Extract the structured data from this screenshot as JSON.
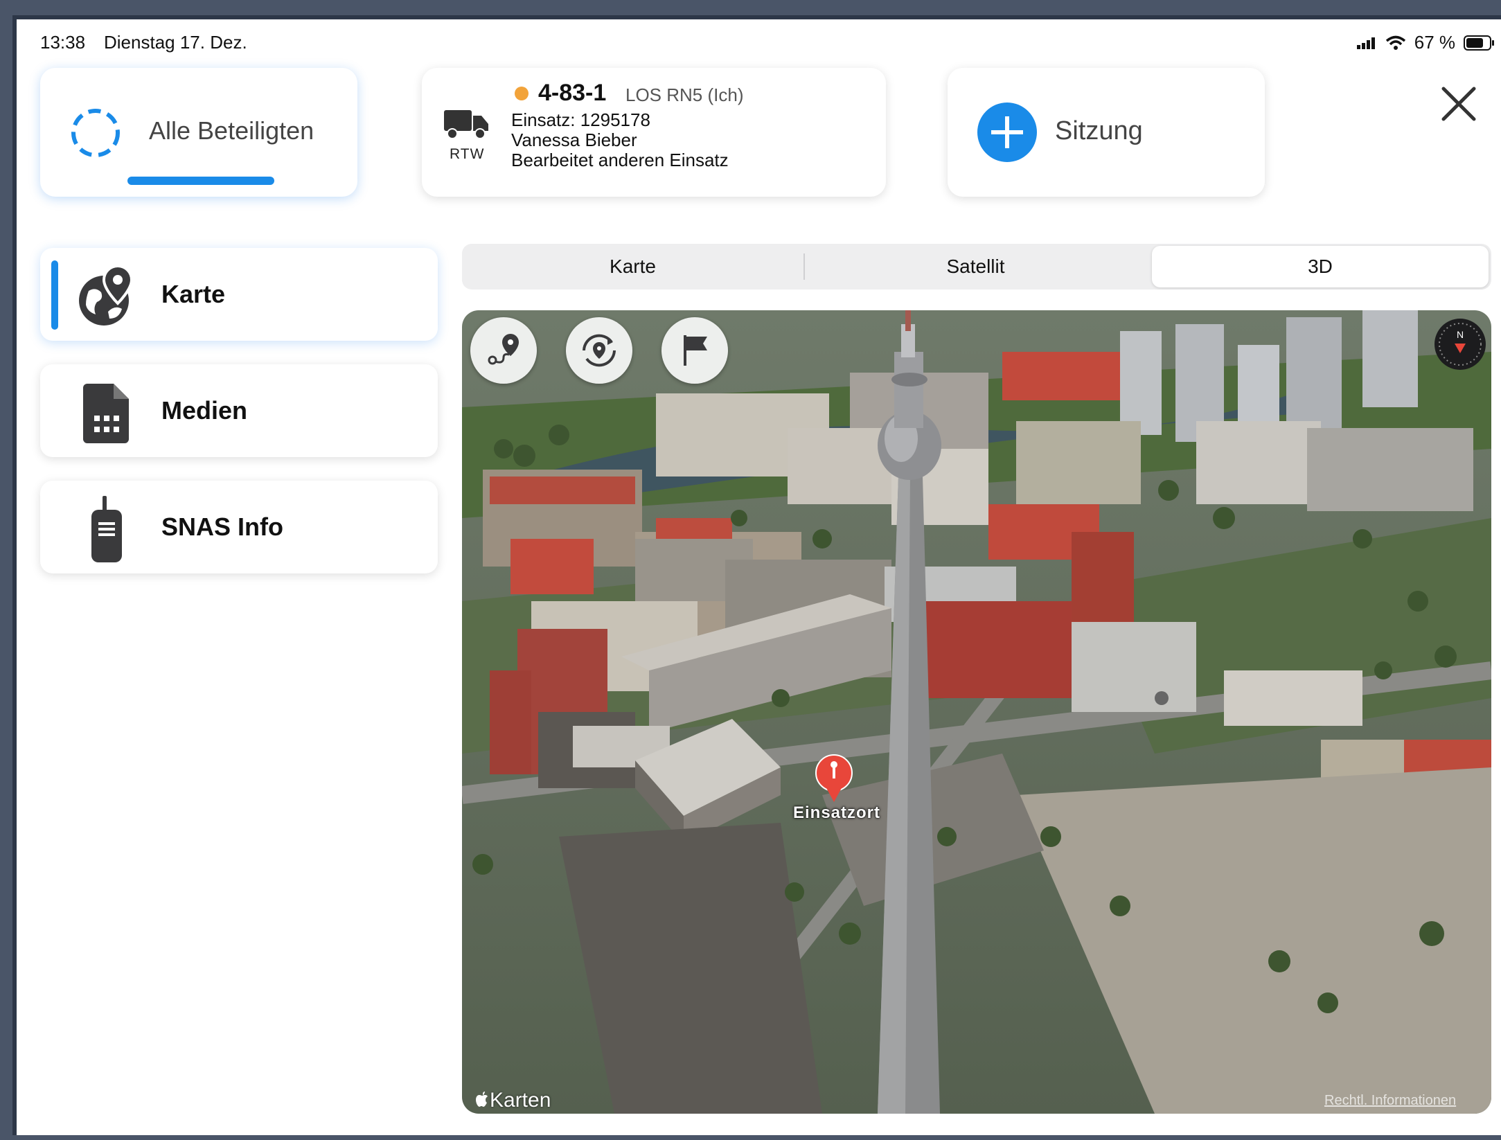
{
  "status": {
    "time": "13:38",
    "date": "Dienstag 17. Dez.",
    "battery": "67 %"
  },
  "header": {
    "all_participants": "Alle Beteiligten",
    "unit": {
      "callsign": "4-83-1",
      "subtitle": "LOS RN5 (Ich)",
      "type": "RTW",
      "line1": "Einsatz: 1295178",
      "line2": "Vanessa Bieber",
      "line3": "Bearbeitet anderen Einsatz",
      "status_color": "#f2a33a"
    },
    "session": "Sitzung"
  },
  "sidebar": {
    "items": [
      {
        "label": "Karte",
        "icon": "globe-pin-icon",
        "active": true
      },
      {
        "label": "Medien",
        "icon": "document-grid-icon",
        "active": false
      },
      {
        "label": "SNAS Info",
        "icon": "walkie-talkie-icon",
        "active": false
      }
    ]
  },
  "map_mode": {
    "options": [
      "Karte",
      "Satellit",
      "3D"
    ],
    "selected": "3D"
  },
  "map": {
    "marker_label": "Einsatzort",
    "attribution": "Karten",
    "legal": "Rechtl. Informationen",
    "compass_letter": "N",
    "buttons": [
      "route-icon",
      "recenter-icon",
      "flag-icon"
    ]
  },
  "colors": {
    "accent": "#1a8be8",
    "marker": "#e8463a"
  }
}
